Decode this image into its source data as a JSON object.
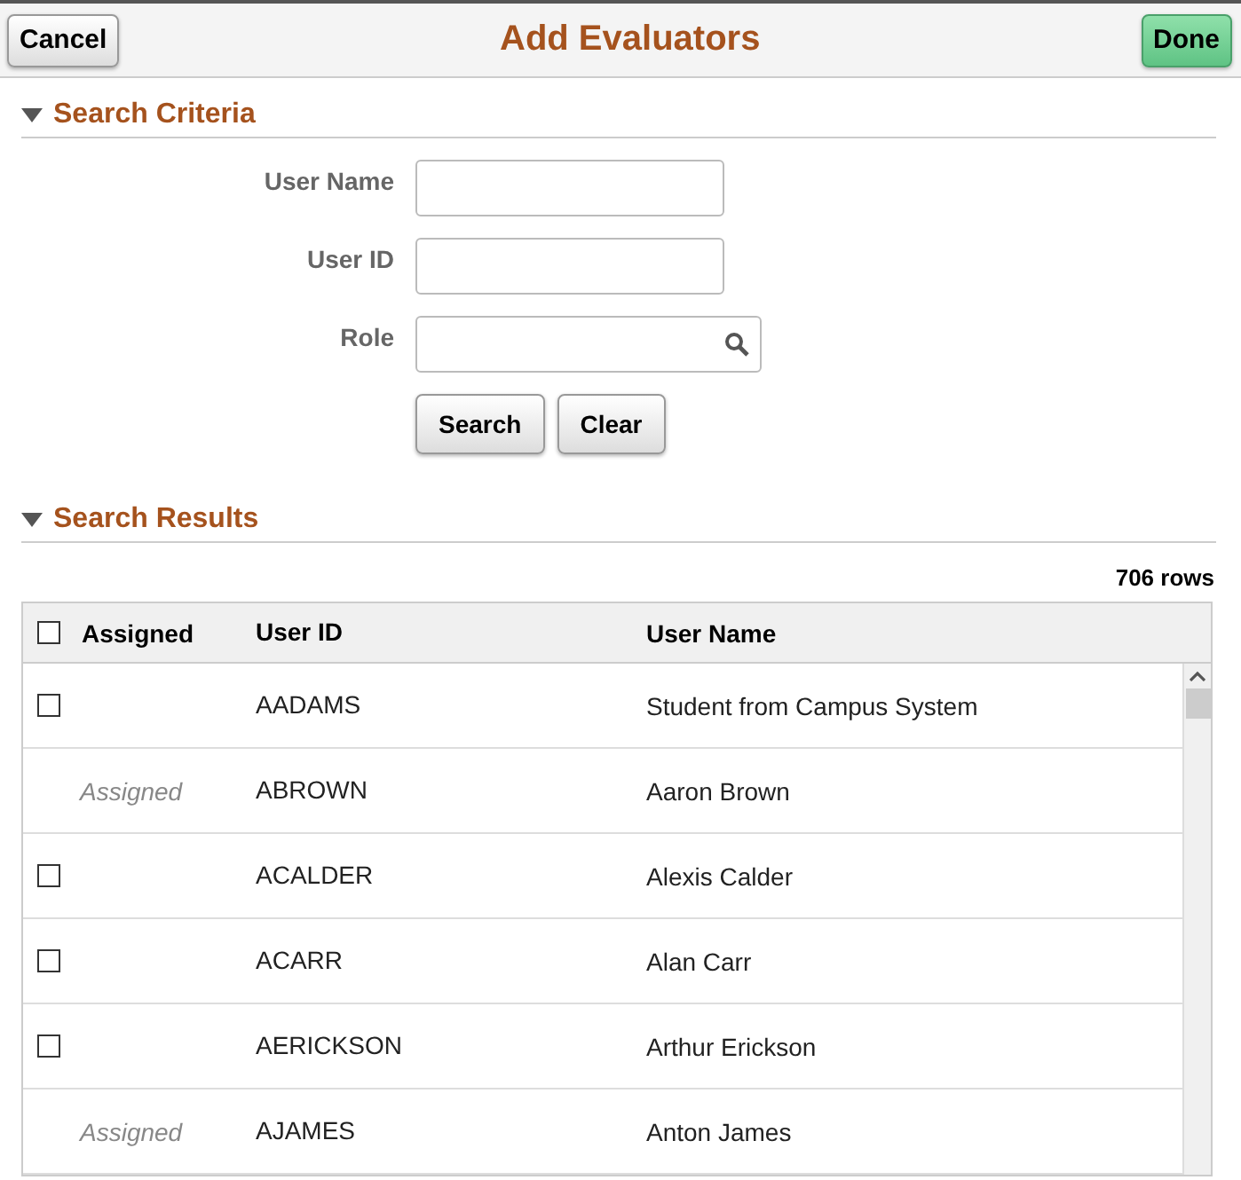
{
  "header": {
    "cancel": "Cancel",
    "title": "Add Evaluators",
    "done": "Done"
  },
  "search_criteria": {
    "title": "Search Criteria",
    "expanded": true,
    "fields": [
      {
        "label": "User Name",
        "kind": "text"
      },
      {
        "label": "User ID",
        "kind": "text"
      },
      {
        "label": "Role",
        "kind": "lookup"
      }
    ],
    "buttons": [
      "Search",
      "Clear"
    ]
  },
  "search_results": {
    "title": "Search Results",
    "expanded": true,
    "row_count": "706 rows",
    "columns": [
      {
        "label": "Assigned",
        "kind": "checkbox",
        "checked": false
      },
      {
        "label": "User ID"
      },
      {
        "label": "User Name"
      }
    ],
    "rows": [
      {
        "kind": "checkbox",
        "checked": false,
        "user_id": "AADAMS",
        "user_name": "Student from Campus System"
      },
      {
        "kind": "assigned",
        "assigned": "Assigned",
        "user_id": "ABROWN",
        "user_name": "Aaron Brown"
      },
      {
        "kind": "checkbox",
        "checked": false,
        "user_id": "ACALDER",
        "user_name": "Alexis Calder"
      },
      {
        "kind": "checkbox",
        "checked": false,
        "user_id": "ACARR",
        "user_name": "Alan Carr"
      },
      {
        "kind": "checkbox",
        "checked": false,
        "user_id": "AERICKSON",
        "user_name": "Arthur Erickson"
      },
      {
        "kind": "assigned",
        "assigned": "Assigned",
        "user_id": "AJAMES",
        "user_name": "Anton James"
      }
    ]
  }
}
